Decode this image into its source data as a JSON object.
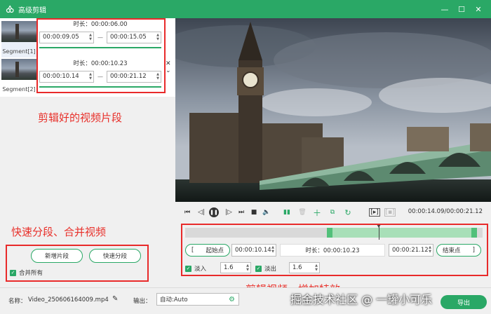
{
  "window": {
    "title": "高级剪辑",
    "minimize": "—",
    "maximize": "☐",
    "close": "✕"
  },
  "segments": [
    {
      "label": "Segment[1]",
      "duration": "时长：00:00:06.00",
      "start": "00:00:09.05",
      "end": "00:00:15.05",
      "progress": 1.0
    },
    {
      "label": "Segment[2]",
      "duration": "时长：00:00:10.23",
      "start": "00:00:10.14",
      "end": "00:00:21.12",
      "progress": 1.0
    }
  ],
  "segment_separator": "—",
  "annotations": {
    "clips": "剪辑好的视频片段",
    "split_merge": "快速分段、合并视频",
    "effects": "剪辑视频，增加特效"
  },
  "left_actions": {
    "new_segment": "新增片段",
    "quick_split": "快速分段",
    "merge_all": "合并所有"
  },
  "player": {
    "current_time": "00:00:14.09",
    "total_time": "00:00:21.12",
    "time_readout": "00:00:14.09/00:00:21.12"
  },
  "range": {
    "start_label": "起始点",
    "start_bracket": "[",
    "start_time": "00:00:10.14",
    "duration": "时长：00:00:10.23",
    "end_time": "00:00:21.12",
    "end_label": "结束点",
    "end_bracket": "]"
  },
  "fade": {
    "in_label": "淡入",
    "in_value": "1.6",
    "out_label": "淡出",
    "out_value": "1.6"
  },
  "bottom": {
    "name_label": "名称：",
    "name_value": "Video_250606164009.mp4",
    "output_label": "输出：",
    "output_value": "自动:Auto",
    "export": "导出"
  },
  "watermark": "掘金技术社区 @ 一罐小可乐",
  "colors": {
    "accent": "#2aa866",
    "annotation": "#e8302a"
  }
}
